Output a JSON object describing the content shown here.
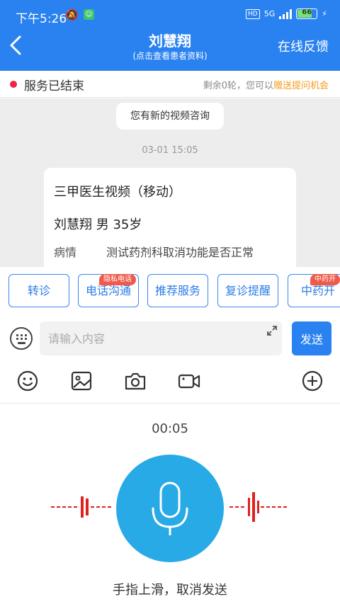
{
  "status_bar": {
    "time": "下午5:26",
    "hd": "HD",
    "net": "5G",
    "battery": "66"
  },
  "header": {
    "title": "刘慧翔",
    "subtitle": "(点击查看患者资料)",
    "feedback": "在线反馈"
  },
  "service": {
    "status": "服务已结束",
    "remain_prefix": "剩余0轮，您可以",
    "gift_link": "赠送提问机会"
  },
  "chat": {
    "system_msg": "您有新的视频咨询",
    "timestamp": "03-01 15:05",
    "card": {
      "line1": "三甲医生视频（移动）",
      "line2": "刘慧翔 男 35岁",
      "label": "病情",
      "value": "测试药剂科取消功能是否正常"
    }
  },
  "quick_actions": [
    {
      "label": "转诊",
      "tag": ""
    },
    {
      "label": "电话沟通",
      "tag": "隐私电话"
    },
    {
      "label": "推荐服务",
      "tag": ""
    },
    {
      "label": "复诊提醒",
      "tag": ""
    },
    {
      "label": "中药开",
      "tag": "中药开"
    }
  ],
  "input": {
    "placeholder": "请输入内容",
    "send": "发送"
  },
  "tools": [
    "emoji-icon",
    "image-icon",
    "camera-icon",
    "video-icon",
    "plus-icon"
  ],
  "voice": {
    "timer": "00:05",
    "hint": "手指上滑，取消发送"
  },
  "colors": {
    "primary": "#2a82f1",
    "mic": "#27aae6",
    "alert": "#ee2244",
    "gift": "#f39b1f",
    "wave": "#e02020"
  }
}
